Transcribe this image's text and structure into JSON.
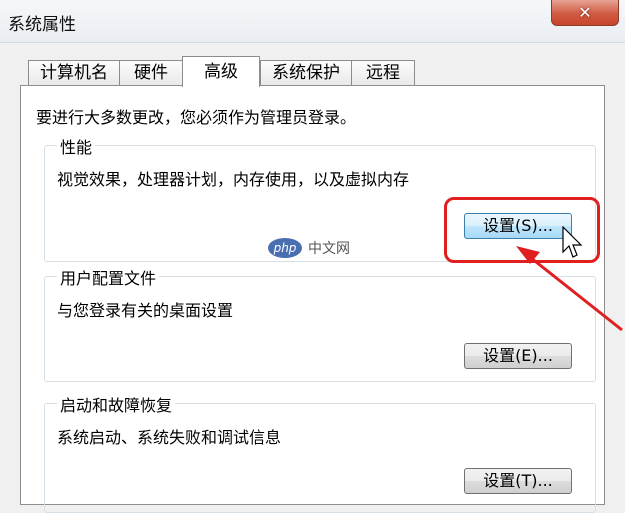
{
  "window": {
    "title": "系统属性",
    "close_glyph": "✕"
  },
  "tabs": [
    {
      "label": "计算机名",
      "active": false
    },
    {
      "label": "硬件",
      "active": false
    },
    {
      "label": "高级",
      "active": true
    },
    {
      "label": "系统保护",
      "active": false
    },
    {
      "label": "远程",
      "active": false
    }
  ],
  "notice": "要进行大多数更改，您必须作为管理员登录。",
  "groups": {
    "performance": {
      "title": "性能",
      "desc": "视觉效果，处理器计划，内存使用，以及虚拟内存",
      "button": "设置(S)..."
    },
    "profile": {
      "title": "用户配置文件",
      "desc": "与您登录有关的桌面设置",
      "button": "设置(E)..."
    },
    "startup": {
      "title": "启动和故障恢复",
      "desc": "系统启动、系统失败和调试信息",
      "button": "设置(T)..."
    }
  },
  "watermark": {
    "logo": "php",
    "text": "中文网"
  },
  "colors": {
    "highlight": "#e02020",
    "close": "#c6452c",
    "hover": "#bee6fd"
  },
  "icons": [
    "close-icon",
    "mouse-cursor-icon",
    "annotation-arrow"
  ]
}
